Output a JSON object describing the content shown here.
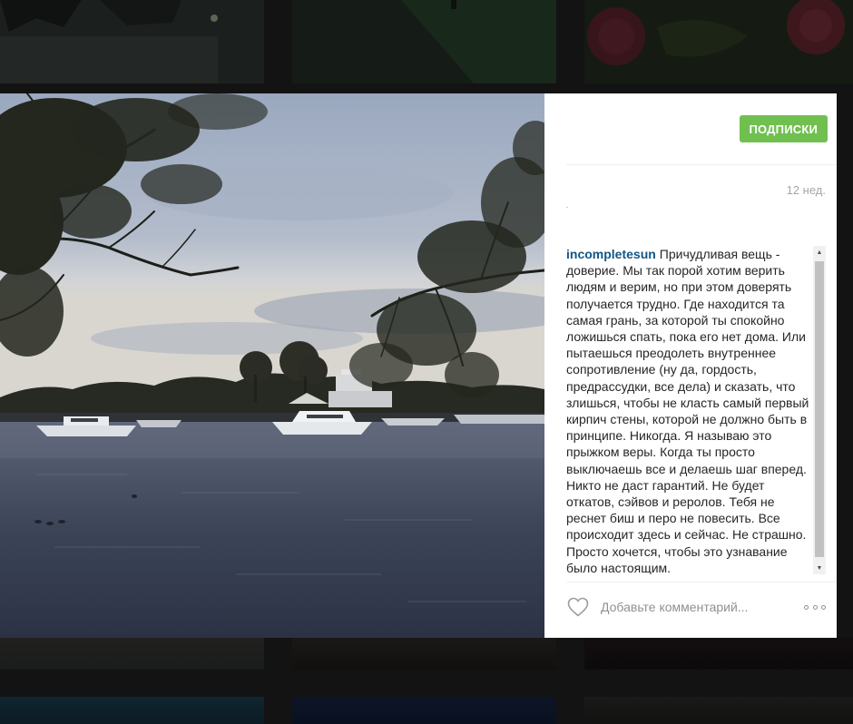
{
  "post": {
    "follow_label": "ПОДПИСКИ",
    "timestamp": "12 нед.",
    "username": "incompletesun",
    "caption": "Причудливая вещь - доверие. Мы так порой хотим верить людям и верим, но при этом доверять получается трудно. Где находится та самая грань, за которой ты спокойно ложишься спать, пока его нет дома. Или пытаешься преодолеть внутреннее сопротивление (ну да, гордость, предрассудки, все дела) и сказать, что злишься, чтобы не класть самый первый кирпич стены, которой не должно быть в принципе. Никогда. Я называю это прыжком веры. Когда ты просто выключаешь все и делаешь шаг вперед. Никто не даст гарантий. Не будет откатов, сэйвов и реролов. Тебя не реснет биш и перо не повесить. Все происходит здесь и сейчас. Не страшно. Просто хочется, чтобы это узнавание было настоящим.",
    "comment_placeholder": "Добавьте комментарий...",
    "photo_subject": "river-harbor-at-dusk"
  },
  "icons": {
    "like": "heart-outline-icon",
    "more": "more-options-icon",
    "scroll_up": "scroll-up-arrow-icon",
    "scroll_down": "scroll-down-arrow-icon"
  },
  "colors": {
    "follow_button": "#70c050",
    "username": "#125688",
    "timestamp": "#a5a7aa"
  }
}
